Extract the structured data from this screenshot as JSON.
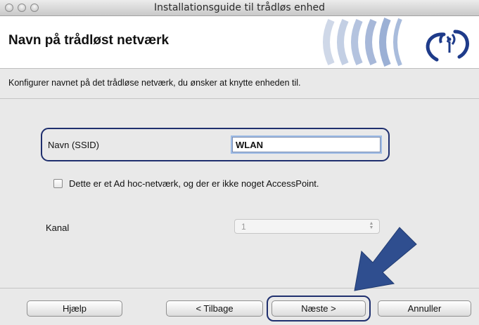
{
  "window": {
    "title": "Installationsguide til trådløs enhed"
  },
  "header": {
    "title": "Navn på trådløst netværk"
  },
  "instruction": "Konfigurer navnet på det trådløse netværk, du ønsker at knytte enheden til.",
  "ssid": {
    "label": "Navn (SSID)",
    "value": "WLAN"
  },
  "adhoc": {
    "label": "Dette er et Ad hoc-netværk, og der er ikke noget AccessPoint.",
    "checked": false
  },
  "channel": {
    "label": "Kanal",
    "value": "1",
    "enabled": false
  },
  "buttons": {
    "help": "Hjælp",
    "back": "< Tilbage",
    "next": "Næste >",
    "cancel": "Annuller"
  },
  "colors": {
    "highlight": "#1f2f6e",
    "arrow": "#2f4e8f",
    "accent_logo": "#1e3b8a"
  },
  "icons": [
    "close-button",
    "minimize-button",
    "zoom-button",
    "wireless-logo-icon",
    "pointer-arrow-icon",
    "stepper-arrows-icon"
  ]
}
